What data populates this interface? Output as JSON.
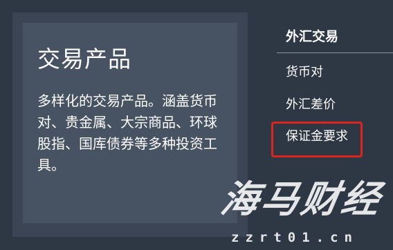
{
  "card": {
    "title": "交易产品",
    "description": "多样化的交易产品。涵盖货币对、贵金属、大宗商品、环球股指、国库债券等多种投资工具。"
  },
  "nav": {
    "heading": "外汇交易",
    "items": [
      {
        "label": "货币对"
      },
      {
        "label": "外汇差价"
      },
      {
        "label": "保证金要求",
        "highlighted": true
      }
    ]
  },
  "watermark": {
    "name": "海马财经",
    "url": "zzrt01.cn"
  },
  "colors": {
    "page_bg": "#2e3744",
    "card_outer": "#3b4554",
    "card_inner": "#475263",
    "highlight_border": "#e0231c",
    "divider": "#8f98a5"
  }
}
